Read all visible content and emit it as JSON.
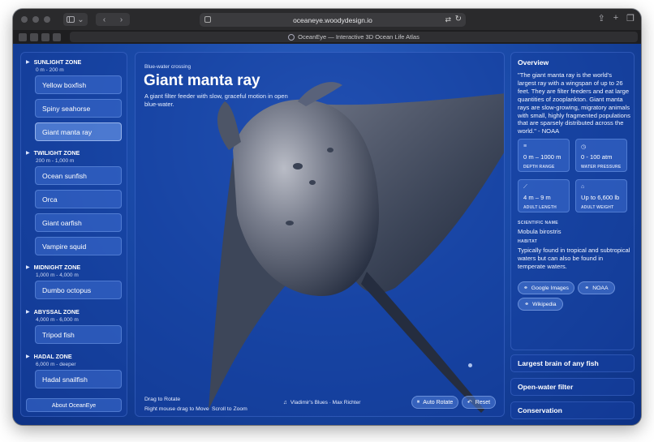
{
  "browser": {
    "url": "oceaneye.woodydesign.io",
    "tab_title": "OceanEye — Interactive 3D Ocean Life Atlas"
  },
  "sidebar": {
    "zones": [
      {
        "title": "SUNLIGHT ZONE",
        "range": "0 m - 200 m",
        "species": [
          "Yellow boxfish",
          "Spiny seahorse",
          "Giant manta ray"
        ]
      },
      {
        "title": "TWILIGHT ZONE",
        "range": "200 m - 1,000 m",
        "species": [
          "Ocean sunfish",
          "Orca",
          "Giant oarfish",
          "Vampire squid"
        ]
      },
      {
        "title": "MIDNIGHT ZONE",
        "range": "1,000 m - 4,000 m",
        "species": [
          "Dumbo octopus"
        ]
      },
      {
        "title": "ABYSSAL ZONE",
        "range": "4,000 m - 6,000 m",
        "species": [
          "Tripod fish"
        ]
      },
      {
        "title": "HADAL ZONE",
        "range": "6,000 m - deeper",
        "species": [
          "Hadal snailfish"
        ]
      }
    ],
    "selected": "Giant manta ray",
    "about_label": "About OceanEye"
  },
  "viewer": {
    "eyebrow": "Blue-water crossing",
    "title": "Giant manta ray",
    "description": "A giant filter feeder with slow, graceful motion in open blue-water.",
    "hint_rotate": "Drag to Rotate",
    "hint_move": "Right mouse drag to Move",
    "hint_zoom": "Scroll to Zoom",
    "music": "Vladimir's Blues · Max Richter",
    "auto_rotate_label": "Auto Rotate",
    "reset_label": "Reset"
  },
  "overview": {
    "title": "Overview",
    "quote": "\"The giant manta ray is the world's largest ray with a wingspan of up to 26 feet. They are filter feeders and eat large quantities of zooplankton. Giant manta rays are slow-growing, migratory animals with small, highly fragmented populations that are sparsely distributed across the world.\" - NOAA",
    "stats": [
      {
        "icon": "depth-icon",
        "value": "0 m – 1000 m",
        "label": "DEPTH RANGE"
      },
      {
        "icon": "gauge-icon",
        "value": "0 - 100 atm",
        "label": "WATER PRESSURE"
      },
      {
        "icon": "ruler-icon",
        "value": "4 m – 9 m",
        "label": "ADULT LENGTH"
      },
      {
        "icon": "weight-icon",
        "value": "Up to 6,600 lb",
        "label": "ADULT WEIGHT"
      }
    ],
    "scientific_label": "SCIENTIFIC NAME",
    "scientific_name": "Mobula birostris",
    "habitat_label": "HABITAT",
    "habitat": "Typically found in tropical and subtropical waters but can also be found in temperate waters.",
    "links": [
      "Google Images",
      "NOAA",
      "Wikipedia"
    ]
  },
  "accordions": [
    "Largest brain of any fish",
    "Open-water filter",
    "Conservation"
  ]
}
